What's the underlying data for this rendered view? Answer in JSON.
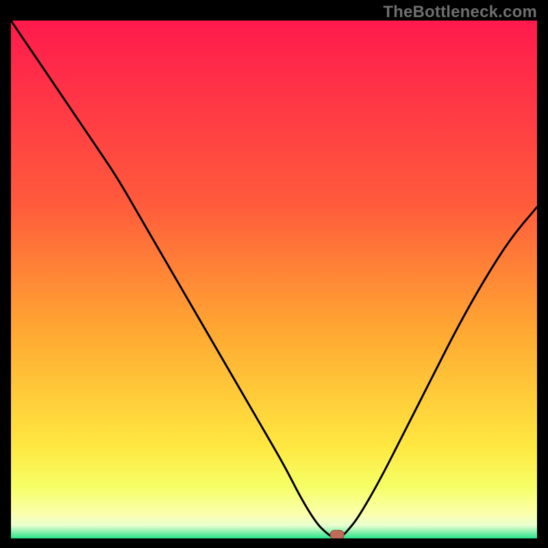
{
  "watermark": "TheBottleneck.com",
  "colors": {
    "bg": "#000000",
    "grad_top": "#ff1a4d",
    "grad_mid1": "#ff5a3c",
    "grad_mid2": "#ffa832",
    "grad_mid3": "#ffe740",
    "grad_yellowish": "#f6ff66",
    "grad_lightyellow": "#fbffb0",
    "grad_pale": "#e8ffd0",
    "grad_green": "#28e48a",
    "curve": "#000000",
    "marker_fill": "#c06a5a",
    "marker_stroke": "#8e4438"
  },
  "chart_data": {
    "type": "line",
    "title": "",
    "xlabel": "",
    "ylabel": "",
    "xlim": [
      0,
      100
    ],
    "ylim": [
      0,
      100
    ],
    "x": [
      0,
      4,
      8,
      12,
      16,
      20,
      24,
      28,
      32,
      36,
      40,
      44,
      48,
      52,
      55,
      58,
      60,
      61.5,
      63,
      64,
      66,
      70,
      75,
      80,
      85,
      90,
      95,
      100
    ],
    "values": [
      100,
      94,
      88,
      82,
      76,
      70,
      63,
      56,
      49,
      42,
      35,
      28,
      21,
      14,
      8,
      3,
      1,
      0,
      0.5,
      1.5,
      4,
      11,
      21,
      31,
      41,
      50,
      58,
      64
    ],
    "marker": {
      "x": 62,
      "y": 0.5
    },
    "gradient_stops": [
      {
        "pos": 0.0,
        "value": 100
      },
      {
        "pos": 0.35,
        "value": 65
      },
      {
        "pos": 0.6,
        "value": 40
      },
      {
        "pos": 0.82,
        "value": 18
      },
      {
        "pos": 0.9,
        "value": 10
      },
      {
        "pos": 0.955,
        "value": 4.5
      },
      {
        "pos": 0.975,
        "value": 2.5
      },
      {
        "pos": 1.0,
        "value": 0
      }
    ]
  }
}
